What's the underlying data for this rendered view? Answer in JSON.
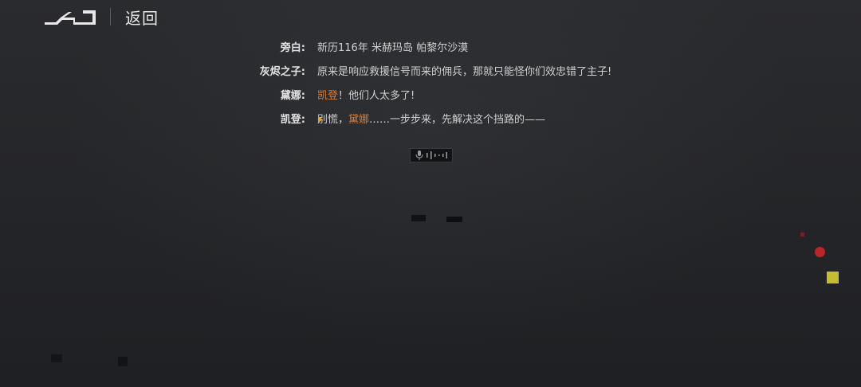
{
  "header": {
    "back_label": "返回",
    "logo_icon": "back-arrow-logo-icon"
  },
  "dialogue": [
    {
      "speaker": "旁白:",
      "text": "新历116年 米赫玛岛 帕黎尔沙漠"
    },
    {
      "speaker": "灰烬之子:",
      "text": "原来是响应救援信号而来的佣兵，那就只能怪你们效忠错了主子!"
    },
    {
      "speaker": "黛娜:",
      "text_parts": [
        {
          "t": "凯登",
          "highlight": true
        },
        {
          "t": "！他们人太多了!",
          "highlight": false
        }
      ]
    },
    {
      "speaker": "凯登:",
      "text_parts": [
        {
          "t": "别慌，",
          "highlight": false
        },
        {
          "t": "黛娜",
          "highlight": true
        },
        {
          "t": "……一步步来，先解决这个挡路的——",
          "highlight": false
        }
      ],
      "current": true
    }
  ],
  "voice_chip": {
    "icon": "microphone-icon"
  },
  "colors": {
    "highlight": "#e07a2e",
    "marker": "#e8a11e",
    "background": "#26272a"
  }
}
